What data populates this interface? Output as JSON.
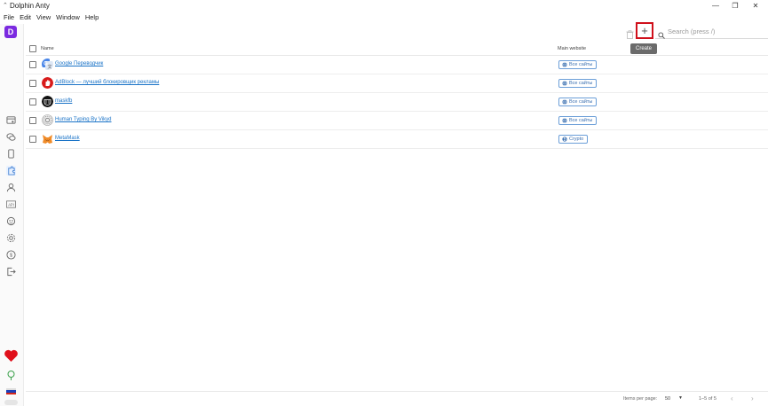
{
  "window": {
    "title": "Dolphin Anty",
    "app_icon": "dolphin-app-icon",
    "controls": [
      "—",
      "❐",
      "✕"
    ]
  },
  "menu": [
    "File",
    "Edit",
    "View",
    "Window",
    "Help"
  ],
  "sidebar": {
    "logo": "D",
    "logo_color": "#7b2ae0",
    "icons": [
      {
        "name": "browser-profiles-icon"
      },
      {
        "name": "chat-icon"
      },
      {
        "name": "bookmark-icon"
      },
      {
        "name": "extensions-icon",
        "active": true
      },
      {
        "name": "users-icon"
      },
      {
        "name": "api-icon"
      },
      {
        "name": "robot-icon"
      },
      {
        "name": "settings-icon"
      },
      {
        "name": "billing-icon"
      },
      {
        "name": "logout-icon"
      }
    ],
    "heart_color": "#e0101b"
  },
  "toolbar": {
    "create_label": "+",
    "create_tooltip": "Create",
    "create_border_color": "#d0101b",
    "search_placeholder": "Search (press /)"
  },
  "table": {
    "columns": {
      "name": "Name",
      "main_website": "Main website"
    },
    "rows": [
      {
        "name": "Google Переводчик",
        "site": "Все сайты",
        "icon": "google-translate-icon"
      },
      {
        "name": "AdBlock — лучший блокировщик рекламы",
        "site": "Все сайты",
        "icon": "adblock-icon"
      },
      {
        "name": "maskfb",
        "site": "Все сайты",
        "icon": "maskfb-icon"
      },
      {
        "name": "Human Typing By Vikyd",
        "site": "Все сайты",
        "icon": "human-typing-icon"
      },
      {
        "name": "MetaMask",
        "site": "Crypto",
        "icon": "metamask-icon"
      }
    ]
  },
  "footer": {
    "items_per_page_label": "Items per page:",
    "items_per_page_value": "50",
    "range": "1–5 of 5"
  }
}
